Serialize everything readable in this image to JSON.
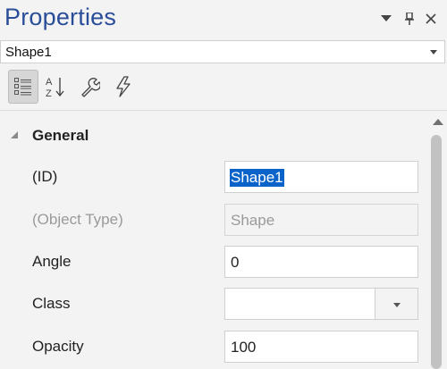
{
  "panel": {
    "title": "Properties",
    "selected_object": "Shape1",
    "colors": {
      "title": "#2a4d9a",
      "selection": "#0a63c9"
    }
  },
  "toolbar": {
    "buttons": [
      {
        "icon": "categorized-icon",
        "active": true
      },
      {
        "icon": "alphabetical-sort-icon",
        "active": false
      },
      {
        "icon": "wrench-icon",
        "active": false
      },
      {
        "icon": "lightning-icon",
        "active": false
      }
    ]
  },
  "grid": {
    "category": "General",
    "properties": [
      {
        "name": "(ID)",
        "value": "Shape1",
        "readonly": false,
        "selected": true
      },
      {
        "name": "(Object Type)",
        "value": "Shape",
        "readonly": true
      },
      {
        "name": "Angle",
        "value": "0",
        "readonly": false
      },
      {
        "name": "Class",
        "value": "",
        "readonly": false,
        "dropdown": true
      },
      {
        "name": "Opacity",
        "value": "100",
        "readonly": false
      }
    ]
  }
}
